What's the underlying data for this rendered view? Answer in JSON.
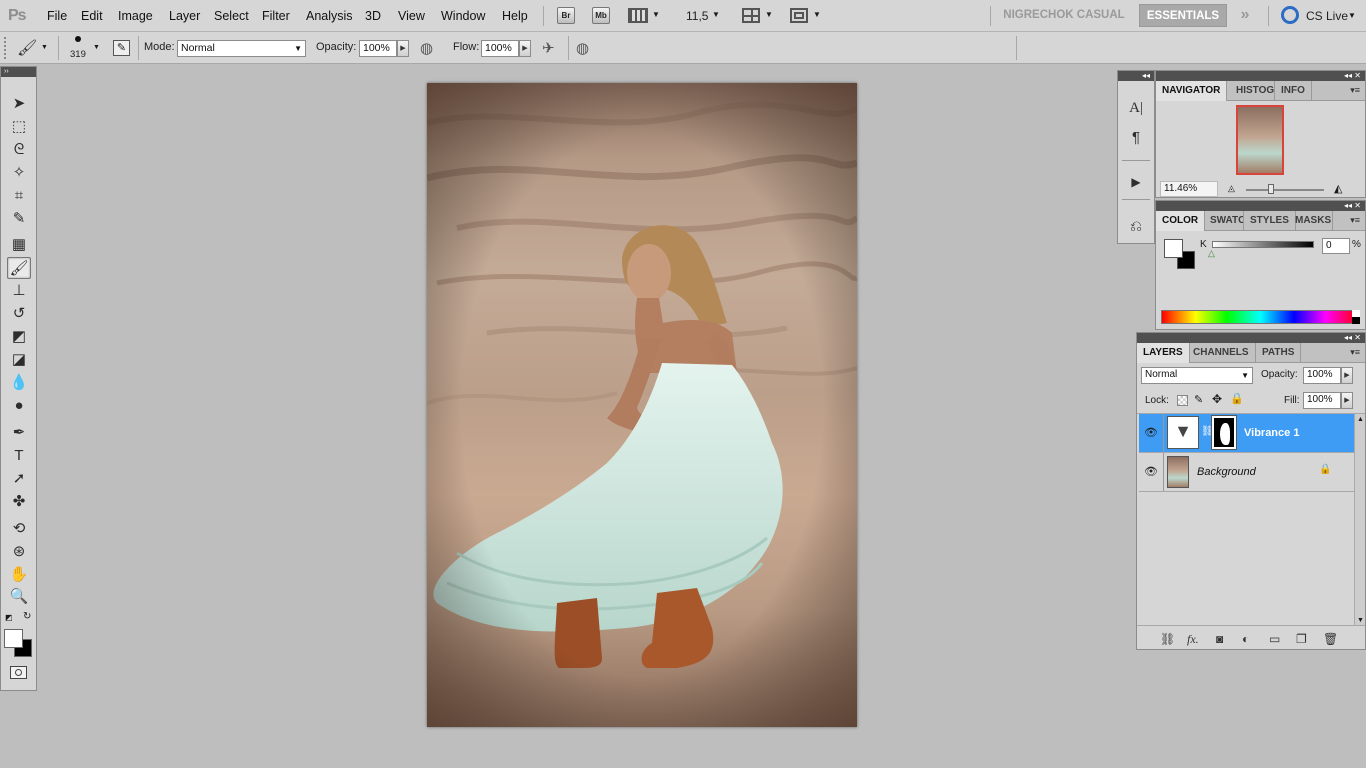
{
  "app": {
    "logo": "Ps"
  },
  "menu": [
    "File",
    "Edit",
    "Image",
    "Layer",
    "Select",
    "Filter",
    "Analysis",
    "3D",
    "View",
    "Window",
    "Help"
  ],
  "menubar_buttons": {
    "bridge": "Br",
    "mini_bridge": "Mb",
    "zoom_value": "11,5"
  },
  "workspaces": {
    "custom": "NIGRECHOK CASUAL",
    "active": "ESSENTIALS",
    "more": "»",
    "cs_live": "CS Live"
  },
  "options": {
    "brush_size": "319",
    "mode_label": "Mode:",
    "mode_value": "Normal",
    "opacity_label": "Opacity:",
    "opacity_value": "100%",
    "flow_label": "Flow:",
    "flow_value": "100%"
  },
  "colors": {
    "foreground": "#ffffff",
    "background": "#000000",
    "selection": "#3f9cf5",
    "chrome": "#d6d6d6"
  },
  "toolbox": [
    {
      "name": "move-tool-icon",
      "glyph": "➤"
    },
    {
      "name": "marquee-tool-icon",
      "glyph": "⬚"
    },
    {
      "name": "lasso-tool-icon",
      "glyph": "ᘓ"
    },
    {
      "name": "quick-selection-tool-icon",
      "glyph": "✧"
    },
    {
      "name": "crop-tool-icon",
      "glyph": "⌗"
    },
    {
      "name": "eyedropper-tool-icon",
      "glyph": "✎"
    },
    {
      "name": "spot-healing-tool-icon",
      "glyph": "▦"
    },
    {
      "name": "brush-tool-icon",
      "glyph": "🖌"
    },
    {
      "name": "clone-stamp-tool-icon",
      "glyph": "⊥"
    },
    {
      "name": "history-brush-tool-icon",
      "glyph": "↺"
    },
    {
      "name": "eraser-tool-icon",
      "glyph": "◩"
    },
    {
      "name": "paint-bucket-tool-icon",
      "glyph": "◪"
    },
    {
      "name": "blur-tool-icon",
      "glyph": "💧"
    },
    {
      "name": "dodge-tool-icon",
      "glyph": "●"
    },
    {
      "name": "pen-tool-icon",
      "glyph": "✒"
    },
    {
      "name": "type-tool-icon",
      "glyph": "T"
    },
    {
      "name": "path-selection-tool-icon",
      "glyph": "➚"
    },
    {
      "name": "custom-shape-tool-icon",
      "glyph": "✤"
    },
    {
      "name": "3d-rotate-tool-icon",
      "glyph": "⟲"
    },
    {
      "name": "3d-orbit-tool-icon",
      "glyph": "⊛"
    },
    {
      "name": "hand-tool-icon",
      "glyph": "✋"
    },
    {
      "name": "zoom-tool-icon",
      "glyph": "🔍"
    }
  ],
  "navigator": {
    "tabs": [
      "NAVIGATOR",
      "HISTOGR",
      "INFO"
    ],
    "zoom": "11.46%"
  },
  "color_panel": {
    "tabs": [
      "COLOR",
      "SWATC",
      "STYLES",
      "MASKS"
    ],
    "channel_label": "K",
    "channel_value": "0",
    "unit": "%"
  },
  "layers_panel": {
    "tabs": [
      "LAYERS",
      "CHANNELS",
      "PATHS"
    ],
    "blend_mode": "Normal",
    "opacity_label": "Opacity:",
    "opacity_value": "100%",
    "lock_label": "Lock:",
    "fill_label": "Fill:",
    "fill_value": "100%",
    "layers": [
      {
        "name": "Vibrance 1",
        "selected": true
      },
      {
        "name": "Background",
        "selected": false,
        "locked": true
      }
    ]
  }
}
